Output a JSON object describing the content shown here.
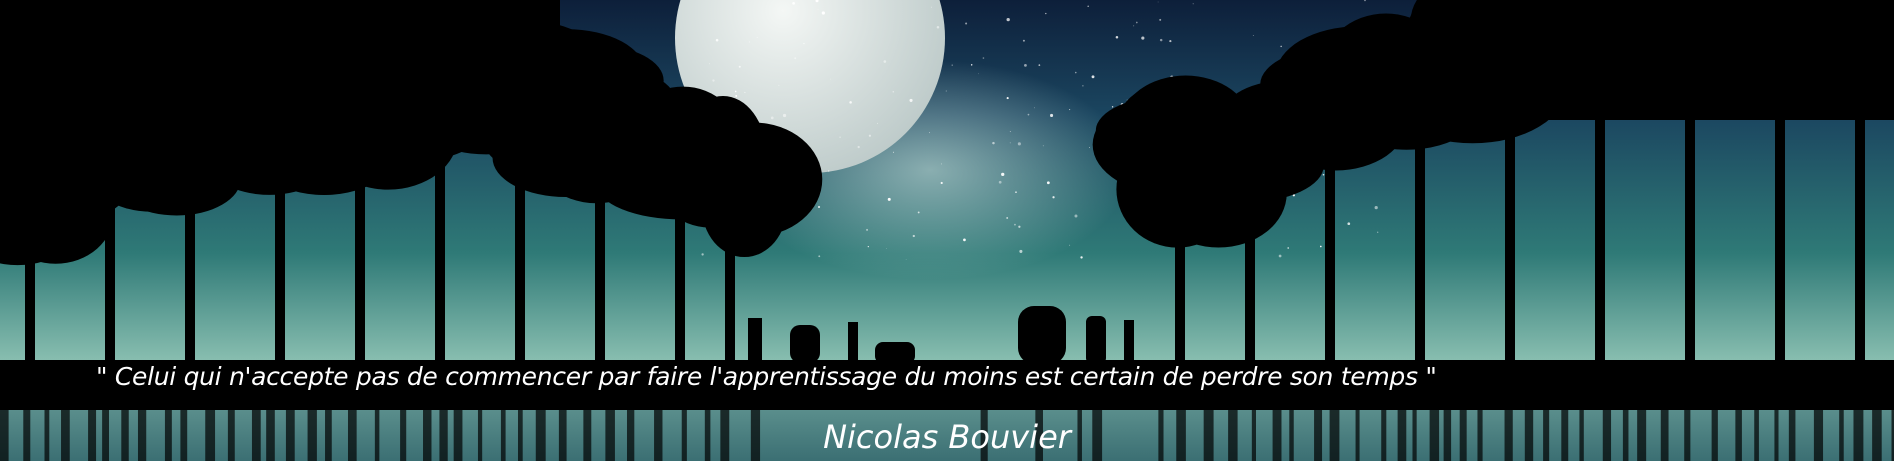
{
  "banner": {
    "quote": "\" Celui qui n'accepte pas de commencer par faire l'apprentissage du moins est certain de perdre son temps \"",
    "author": "Nicolas Bouvier"
  },
  "colors": {
    "sky_top": "#0d1f3a",
    "sky_mid": "#2f7a77",
    "horizon": "#a6d2c4",
    "moon": "#e6ecea",
    "silhouette": "#000000"
  }
}
